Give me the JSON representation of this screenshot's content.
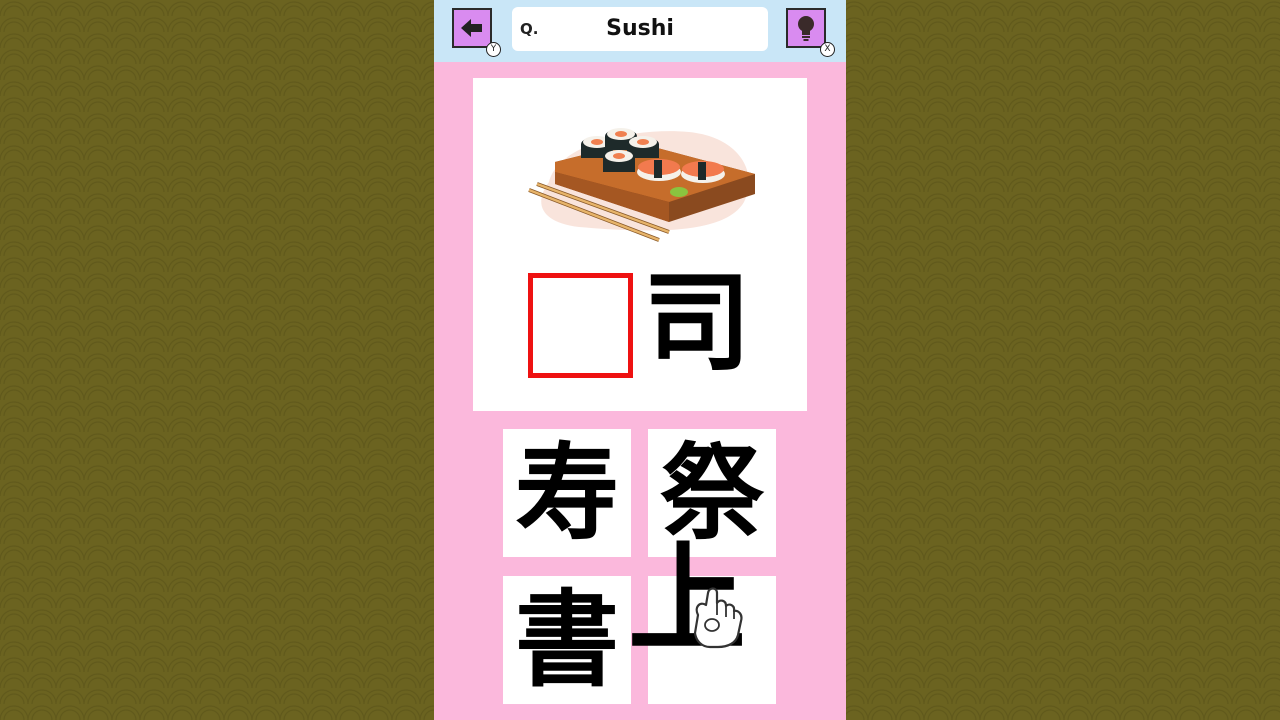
{
  "header": {
    "back_badge": "Y",
    "hint_badge": "X",
    "question_prefix": "Q.",
    "question_word": "Sushi"
  },
  "puzzle": {
    "given_kanji": "司"
  },
  "choices": [
    {
      "kanji": "寿"
    },
    {
      "kanji": "祭"
    },
    {
      "kanji": "書"
    },
    {
      "kanji": "上"
    }
  ],
  "icons": {
    "back": "left-arrow-icon",
    "hint": "lightbulb-icon",
    "cursor": "pointing-hand-icon"
  },
  "colors": {
    "panel": "#fbb8dc",
    "header": "#c9e6f7",
    "button": "#d98bf0",
    "blank_border": "#ee1111"
  }
}
